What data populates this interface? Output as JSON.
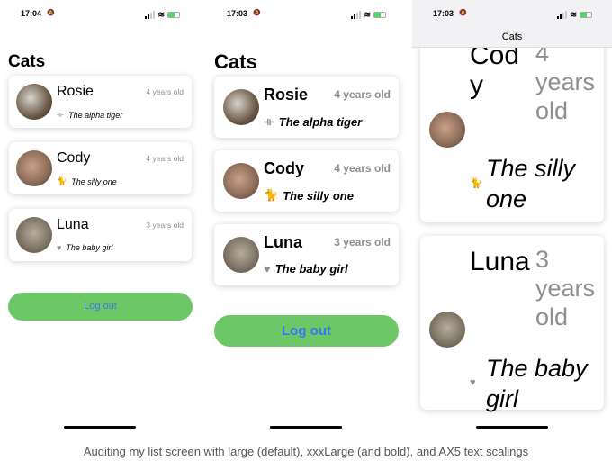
{
  "panels": [
    {
      "time": "17:04",
      "title": "Cats",
      "logout": "Log out",
      "cats": [
        {
          "name": "Rosie",
          "age": "4 years old",
          "tagline": "The alpha tiger",
          "icon": "dumbbell-icon"
        },
        {
          "name": "Cody",
          "age": "4 years old",
          "tagline": "The silly one",
          "icon": "cat-icon"
        },
        {
          "name": "Luna",
          "age": "3 years old",
          "tagline": "The baby girl",
          "icon": "heart-icon"
        }
      ]
    },
    {
      "time": "17:03",
      "title": "Cats",
      "logout": "Log out",
      "cats": [
        {
          "name": "Rosie",
          "age": "4 years old",
          "tagline": "The alpha tiger",
          "icon": "dumbbell-icon"
        },
        {
          "name": "Cody",
          "age": "4 years old",
          "tagline": "The silly one",
          "icon": "cat-icon"
        },
        {
          "name": "Luna",
          "age": "3 years old",
          "tagline": "The baby girl",
          "icon": "heart-icon"
        }
      ]
    },
    {
      "time": "17:03",
      "title": "Cats",
      "cats": [
        {
          "name": "Cody",
          "age": "4 years old",
          "tagline": "The silly one",
          "icon": "cat-icon"
        },
        {
          "name": "Luna",
          "age": "3 years old",
          "tagline": "The baby girl",
          "icon": "heart-icon"
        }
      ]
    }
  ],
  "colors": {
    "button": "#6cc867",
    "button_text": "#3478f6",
    "secondary": "#8e8e93"
  },
  "caption": "Auditing my list screen with large (default), xxxLarge (and bold), and AX5 text scalings"
}
